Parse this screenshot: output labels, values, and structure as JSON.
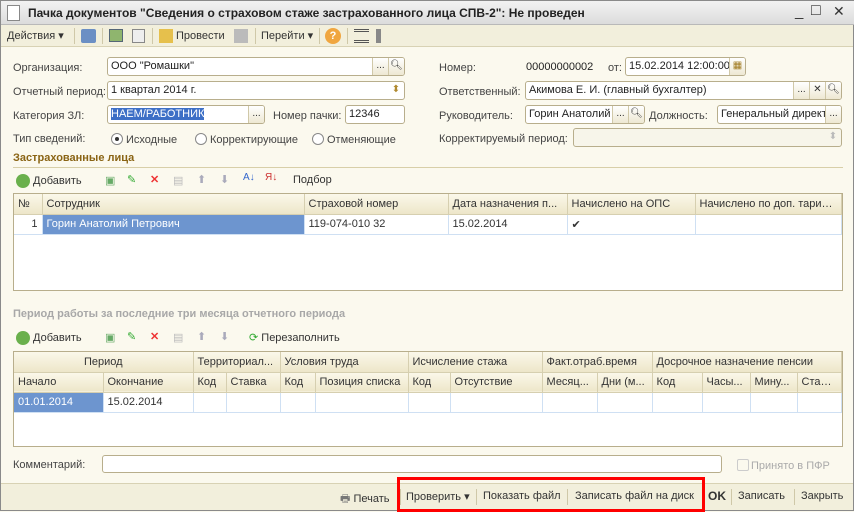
{
  "window": {
    "title": "Пачка документов \"Сведения о страховом стаже застрахованного лица СПВ-2\": Не проведен",
    "controls": [
      "_",
      "□",
      "✕"
    ]
  },
  "toolbar": {
    "actions": "Действия",
    "post": "Провести",
    "goto": "Перейти",
    "help": "?"
  },
  "form": {
    "org_label": "Организация:",
    "org_value": "ООО \"Ромашки\"",
    "period_label": "Отчетный период:",
    "period_value": "1 квартал 2014 г.",
    "category_label": "Категория ЗЛ:",
    "category_value": "НАЕМ/РАБОТНИК",
    "pack_label": "Номер пачки:",
    "pack_value": "12346",
    "type_label": "Тип сведений:",
    "types": [
      {
        "label": "Исходные",
        "checked": true
      },
      {
        "label": "Корректирующие",
        "checked": false
      },
      {
        "label": "Отменяющие",
        "checked": false
      }
    ],
    "number_label": "Номер:",
    "number_value": "00000000002",
    "from_label": "от:",
    "date_value": "15.02.2014 12:00:00",
    "resp_label": "Ответственный:",
    "resp_value": "Акимова Е. И. (главный бухгалтер)",
    "head_label": "Руководитель:",
    "head_value": "Горин Анатолий",
    "position_label": "Должность:",
    "position_value": "Генеральный директ",
    "corr_label": "Корректируемый период:",
    "corr_value": ""
  },
  "insured": {
    "title": "Застрахованные лица",
    "add": "Добавить",
    "pick": "Подбор",
    "columns": [
      "№",
      "Сотрудник",
      "Страховой номер",
      "Дата назначения п...",
      "Начислено на ОПС",
      "Начислено по доп. тариф..."
    ],
    "rows": [
      {
        "n": "1",
        "employee": "Горин Анатолий Петрович",
        "snils": "119-074-010 32",
        "date": "15.02.2014",
        "ops": "✔",
        "extra": ""
      }
    ]
  },
  "periods": {
    "title": "Период работы за последние три месяца отчетного периода",
    "add": "Добавить",
    "refill": "Перезаполнить",
    "groups": [
      "Период",
      "Территориал...",
      "Условия труда",
      "Исчисление стажа",
      "Факт.отраб.время",
      "Досрочное назначение пенсии"
    ],
    "columns": [
      "Начало",
      "Окончание",
      "Код",
      "Ставка",
      "Код",
      "Позиция списка",
      "Код",
      "Отсутствие",
      "Месяц...",
      "Дни (м...",
      "Код",
      "Часы...",
      "Мину...",
      "Ставка"
    ],
    "rows": [
      [
        "01.01.2014",
        "15.02.2014",
        "",
        "",
        "",
        "",
        "",
        "",
        "",
        "",
        "",
        "",
        "",
        ""
      ]
    ]
  },
  "comment": {
    "label": "Комментарий:",
    "value": "",
    "accepted_label": "Принято в ПФР",
    "accepted": false
  },
  "bottom": {
    "print": "Печать",
    "check": "Проверить",
    "show_file": "Показать файл",
    "save_file": "Записать файл на диск",
    "ok": "OK",
    "save": "Записать",
    "close": "Закрыть"
  },
  "colors": {
    "highlight": "#ff0000",
    "selection": "#6d95cf",
    "section": "#8a6414"
  }
}
